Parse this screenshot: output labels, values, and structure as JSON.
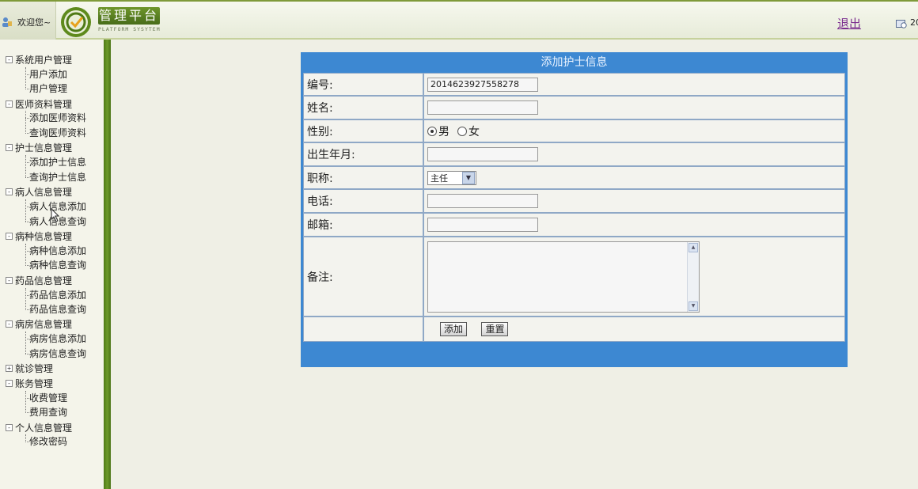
{
  "header": {
    "welcome": "欢迎您~",
    "logo_title": "管理平台",
    "logo_subtitle": "PLATFORM SYSYTEM",
    "logout": "退出",
    "date_fragment": "20"
  },
  "sidebar": {
    "groups": [
      {
        "label": "系统用户管理",
        "toggle": "-",
        "children": [
          "用户添加",
          "用户管理"
        ]
      },
      {
        "label": "医师资料管理",
        "toggle": "-",
        "children": [
          "添加医师资料",
          "查询医师资料"
        ]
      },
      {
        "label": "护士信息管理",
        "toggle": "-",
        "children": [
          "添加护士信息",
          "查询护士信息"
        ]
      },
      {
        "label": "病人信息管理",
        "toggle": "-",
        "children": [
          "病人信息添加",
          "病人信息查询"
        ]
      },
      {
        "label": "病种信息管理",
        "toggle": "-",
        "children": [
          "病种信息添加",
          "病种信息查询"
        ]
      },
      {
        "label": "药品信息管理",
        "toggle": "-",
        "children": [
          "药品信息添加",
          "药品信息查询"
        ]
      },
      {
        "label": "病房信息管理",
        "toggle": "-",
        "children": [
          "病房信息添加",
          "病房信息查询"
        ]
      },
      {
        "label": "就诊管理",
        "toggle": "+",
        "children": []
      },
      {
        "label": "账务管理",
        "toggle": "-",
        "children": [
          "收费管理",
          "费用查询"
        ]
      },
      {
        "label": "个人信息管理",
        "toggle": "-",
        "children": [
          "修改密码"
        ]
      }
    ]
  },
  "form": {
    "title": "添加护士信息",
    "fields": {
      "id_label": "编号:",
      "id_value": "2014623927558278",
      "name_label": "姓名:",
      "gender_label": "性别:",
      "gender_male": "男",
      "gender_female": "女",
      "birth_label": "出生年月:",
      "title_label": "职称:",
      "title_value": "主任",
      "phone_label": "电话:",
      "email_label": "邮箱:",
      "notes_label": "备注:"
    },
    "buttons": {
      "add": "添加",
      "reset": "重置"
    }
  },
  "colors": {
    "accent_green": "#5f8a22",
    "form_blue": "#3d88d2",
    "logout_purple": "#7a2b8e"
  }
}
